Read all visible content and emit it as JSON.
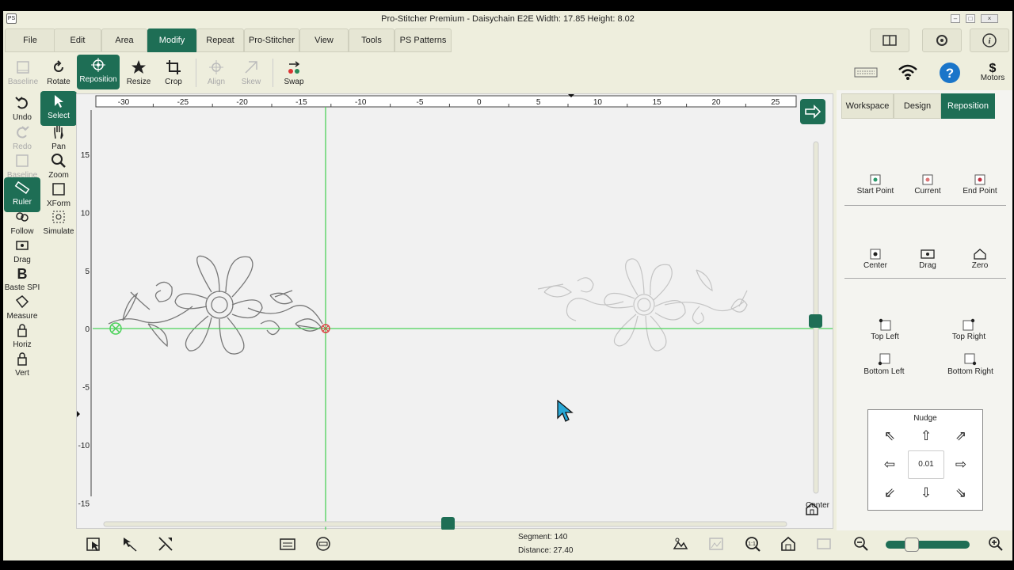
{
  "window": {
    "app_icon": "PS",
    "title": "Pro-Stitcher Premium   -   Daisychain E2E   Width: 17.85   Height: 8.02"
  },
  "menu": {
    "tabs": [
      "File",
      "Edit",
      "Area",
      "Modify",
      "Repeat",
      "Pro-Stitcher",
      "View",
      "Tools",
      "PS Patterns"
    ],
    "active": "Modify"
  },
  "toolbar": {
    "baseline": "Baseline",
    "rotate": "Rotate",
    "reposition": "Reposition",
    "resize": "Resize",
    "crop": "Crop",
    "align": "Align",
    "skew": "Skew",
    "swap": "Swap",
    "motors": "Motors"
  },
  "left_tools": {
    "undo": "Undo",
    "select": "Select",
    "redo": "Redo",
    "pan": "Pan",
    "baseline": "Baseline",
    "zoom": "Zoom",
    "ruler": "Ruler",
    "xform": "XForm",
    "follow": "Follow",
    "simulate": "Simulate",
    "drag": "Drag",
    "baste": "Baste SPI",
    "measure": "Measure",
    "horiz": "Horiz",
    "vert": "Vert"
  },
  "ruler": {
    "x_ticks": [
      "-30",
      "-25",
      "-20",
      "-15",
      "-10",
      "-5",
      "0",
      "5",
      "10",
      "15",
      "20",
      "25"
    ],
    "y_ticks": [
      "15",
      "10",
      "5",
      "0",
      "-5",
      "-10",
      "-15"
    ]
  },
  "canvas": {
    "center_label": "Center"
  },
  "right_panel": {
    "tabs": [
      "Workspace",
      "Design",
      "Reposition"
    ],
    "active_tab": "Reposition",
    "start_point": "Start Point",
    "current": "Current",
    "end_point": "End Point",
    "center": "Center",
    "drag": "Drag",
    "zero": "Zero",
    "top_left": "Top Left",
    "top_right": "Top Right",
    "bottom_left": "Bottom Left",
    "bottom_right": "Bottom Right",
    "nudge_title": "Nudge",
    "nudge_value": "0.01"
  },
  "status": {
    "segment_label": "Segment:",
    "segment_value": "140",
    "distance_label": "Distance:",
    "distance_value": "27.40",
    "zoom_level": 0.27
  },
  "colors": {
    "accent": "#1e6e55",
    "guide": "#4cd25a",
    "background": "#eeeedd"
  }
}
